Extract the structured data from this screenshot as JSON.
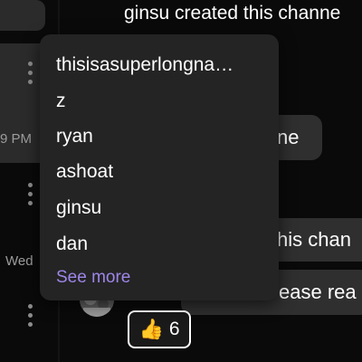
{
  "thread_list": {
    "times": [
      "9 PM",
      "Wed"
    ]
  },
  "chat": {
    "system_message": "ginsu created this channe",
    "bubbles": [
      "ne",
      "his chan",
      "ease rea"
    ],
    "reaction": {
      "emoji": "👍",
      "count": "6"
    }
  },
  "popover": {
    "users": [
      "thisisasuperlongna…",
      "z",
      "ryan",
      "ashoat",
      "ginsu",
      "dan"
    ],
    "see_more_label": "See more"
  },
  "colors": {
    "background": "#0a0a0a",
    "popover": "#242424",
    "bubble": "#2f2f2f",
    "link_accent": "#9e86e8"
  }
}
